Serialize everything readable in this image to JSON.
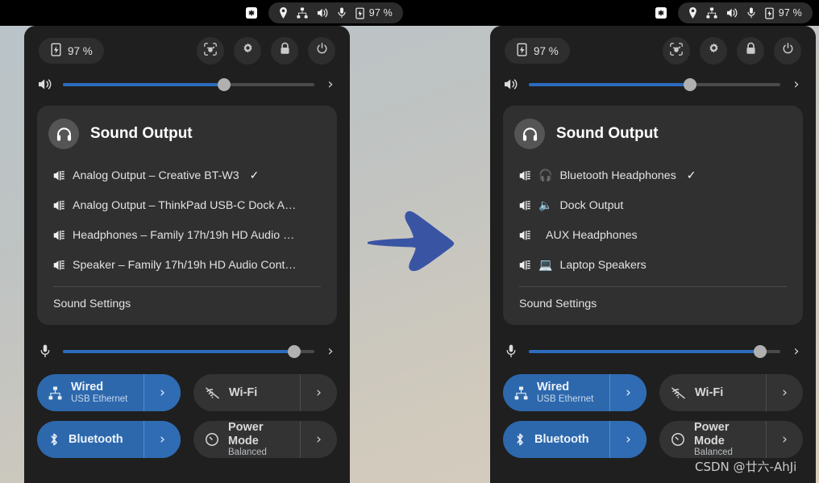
{
  "topbar": {
    "halves": [
      {
        "solo_icon": "apps-grid-icon",
        "tray_icons": [
          "location-icon",
          "network-wired-icon",
          "volume-icon",
          "microphone-icon"
        ],
        "battery_icon": "battery-charging-icon",
        "battery": "97 %"
      },
      {
        "solo_icon": "apps-grid-icon",
        "tray_icons": [
          "location-icon",
          "network-wired-icon",
          "volume-icon",
          "microphone-icon"
        ],
        "battery_icon": "battery-charging-icon",
        "battery": "97 %"
      }
    ]
  },
  "colors": {
    "accent_blue": "#2c6bbe",
    "toggle_active": "#2d68ad",
    "panel_bg": "#1f1f1f",
    "card_bg": "#303030",
    "arrow_blue": "#3a54a4"
  },
  "panels": [
    {
      "id": "before",
      "header": {
        "battery_icon": "battery-charging-icon",
        "battery": "97 %",
        "buttons": [
          {
            "name": "screenshot-button",
            "icon": "screenshot-icon"
          },
          {
            "name": "settings-button",
            "icon": "gear-icon"
          },
          {
            "name": "lock-button",
            "icon": "lock-icon"
          },
          {
            "name": "power-button",
            "icon": "power-icon"
          }
        ]
      },
      "volume_slider": {
        "icon": "volume-icon",
        "value": 64,
        "chevron": "›"
      },
      "mic_slider": {
        "icon": "microphone-icon",
        "value": 92,
        "chevron": "›"
      },
      "sound_card": {
        "icon": "headphones-icon",
        "title": "Sound Output",
        "options": [
          {
            "icon": "audio-output-icon",
            "emoji": "",
            "label": "Analog Output – Creative BT-W3",
            "checked": true,
            "check": "✓"
          },
          {
            "icon": "audio-output-icon",
            "emoji": "",
            "label": "Analog Output – ThinkPad USB-C Dock A…",
            "checked": false,
            "check": ""
          },
          {
            "icon": "audio-output-icon",
            "emoji": "",
            "label": "Headphones – Family 17h/19h HD Audio …",
            "checked": false,
            "check": ""
          },
          {
            "icon": "audio-output-icon",
            "emoji": "",
            "label": "Speaker – Family 17h/19h HD Audio Cont…",
            "checked": false,
            "check": ""
          }
        ],
        "settings_label": "Sound Settings"
      },
      "quick_toggles": [
        {
          "name": "wired-toggle",
          "icon": "network-wired-icon",
          "label": "Wired",
          "sub": "USB Ethernet",
          "active": true,
          "arrow": "›"
        },
        {
          "name": "wifi-toggle",
          "icon": "wifi-disabled-icon",
          "label": "Wi-Fi",
          "sub": "",
          "active": false,
          "arrow": "›"
        },
        {
          "name": "bluetooth-toggle",
          "icon": "bluetooth-icon",
          "label": "Bluetooth",
          "sub": "",
          "active": true,
          "arrow": "›"
        },
        {
          "name": "power-mode-toggle",
          "icon": "power-mode-icon",
          "label": "Power Mode",
          "sub": "Balanced",
          "active": false,
          "arrow": "›"
        }
      ]
    },
    {
      "id": "after",
      "header": {
        "battery_icon": "battery-charging-icon",
        "battery": "97 %",
        "buttons": [
          {
            "name": "screenshot-button",
            "icon": "screenshot-icon"
          },
          {
            "name": "settings-button",
            "icon": "gear-icon"
          },
          {
            "name": "lock-button",
            "icon": "lock-icon"
          },
          {
            "name": "power-button",
            "icon": "power-icon"
          }
        ]
      },
      "volume_slider": {
        "icon": "volume-icon",
        "value": 64,
        "chevron": "›"
      },
      "mic_slider": {
        "icon": "microphone-icon",
        "value": 92,
        "chevron": "›"
      },
      "sound_card": {
        "icon": "headphones-icon",
        "title": "Sound Output",
        "options": [
          {
            "icon": "audio-output-icon",
            "emoji": "🎧",
            "label": "Bluetooth Headphones",
            "checked": true,
            "check": "✓"
          },
          {
            "icon": "audio-output-icon",
            "emoji": "🔈",
            "label": "Dock Output",
            "checked": false,
            "check": ""
          },
          {
            "icon": "audio-output-icon",
            "emoji": "",
            "label": "AUX Headphones",
            "checked": false,
            "check": ""
          },
          {
            "icon": "audio-output-icon",
            "emoji": "💻",
            "label": "Laptop Speakers",
            "checked": false,
            "check": ""
          }
        ],
        "settings_label": "Sound Settings"
      },
      "quick_toggles": [
        {
          "name": "wired-toggle",
          "icon": "network-wired-icon",
          "label": "Wired",
          "sub": "USB Ethernet",
          "active": true,
          "arrow": "›"
        },
        {
          "name": "wifi-toggle",
          "icon": "wifi-disabled-icon",
          "label": "Wi-Fi",
          "sub": "",
          "active": false,
          "arrow": "›"
        },
        {
          "name": "bluetooth-toggle",
          "icon": "bluetooth-icon",
          "label": "Bluetooth",
          "sub": "",
          "active": true,
          "arrow": "›"
        },
        {
          "name": "power-mode-toggle",
          "icon": "power-mode-icon",
          "label": "Power Mode",
          "sub": "Balanced",
          "active": false,
          "arrow": "›"
        }
      ]
    }
  ],
  "annotation": {
    "arrow_icon": "right-arrow-annotation"
  },
  "watermark": {
    "text": "CSDN @廿六-AhJi"
  }
}
